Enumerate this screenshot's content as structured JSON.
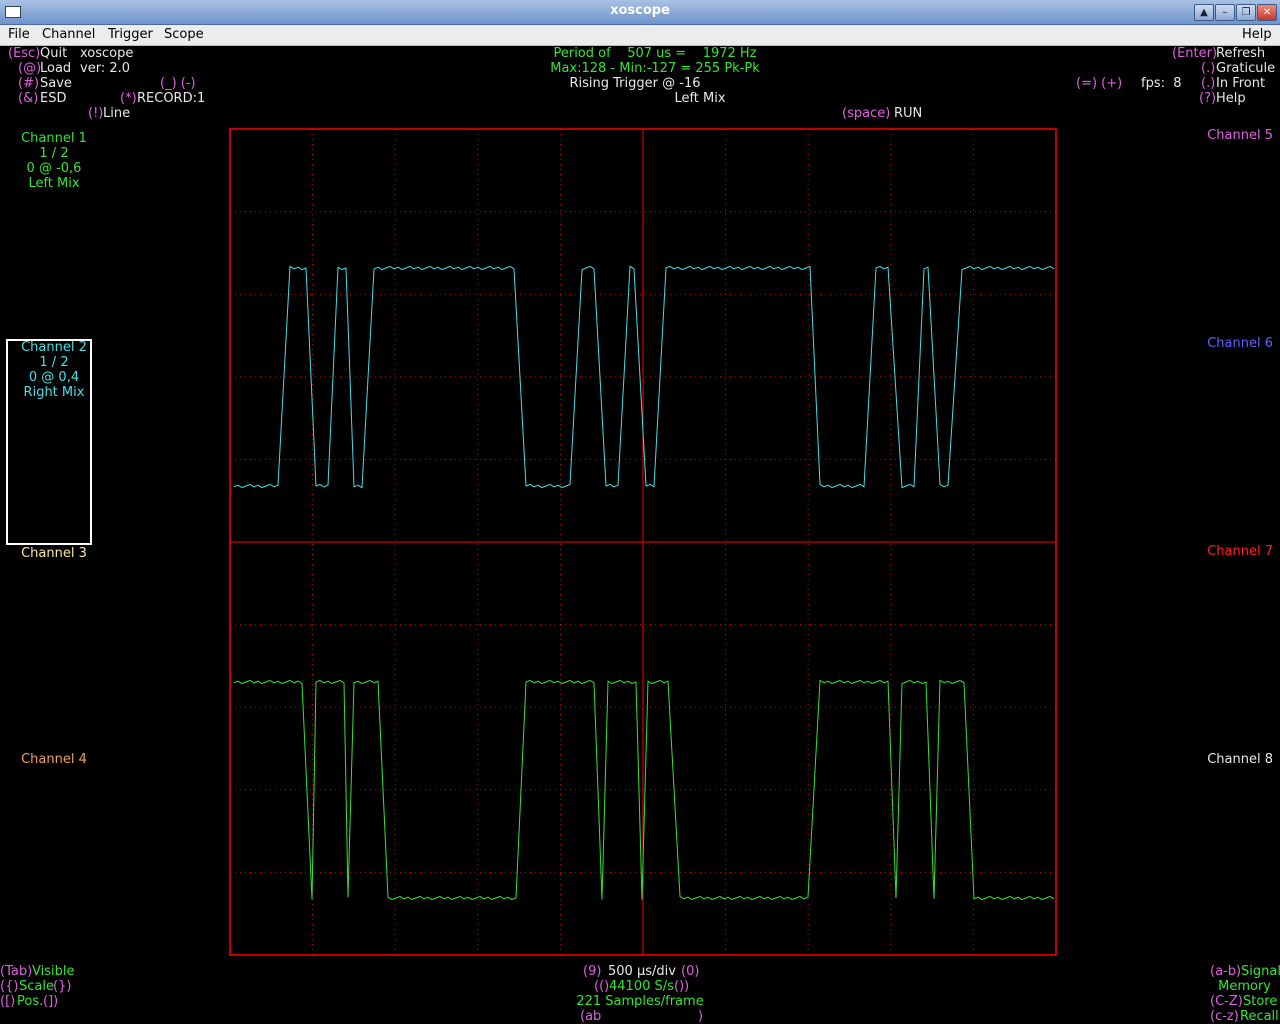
{
  "window": {
    "title": "xoscope"
  },
  "menu": [
    "File",
    "Channel",
    "Trigger",
    "Scope",
    "Help"
  ],
  "top_left": {
    "quit_key": "(Esc)",
    "quit_label": "Quit",
    "app_name": "xoscope",
    "load_key": "(@)",
    "load_label": "Load",
    "version": "ver: 2.0",
    "save_key": "(#)",
    "save_label": "Save",
    "scale_keys": "(_) (-)",
    "esd_key": "(&)",
    "esd_label": "ESD",
    "record_key": "(*)",
    "record_label": "RECORD:1",
    "line_key": "(!)",
    "line_label": "Line"
  },
  "top_center": {
    "period": "Period of    507 us =    1972 Hz",
    "minmax": "Max:128 - Min:-127 = 255 Pk-Pk",
    "trigger": "Rising Trigger @ -16",
    "source": "Left Mix",
    "run_key": "(space)",
    "run_label": "RUN"
  },
  "top_right": {
    "refresh_key": "(Enter)",
    "refresh_label": "Refresh",
    "graticule_key": "(.)",
    "graticule_label": "Graticule",
    "fps_keys": "(=) (+)",
    "fps_label": "fps:  8",
    "front_key": "(.)",
    "front_label": "In Front",
    "help_key": "(?)",
    "help_label": "Help"
  },
  "channels_left": [
    {
      "name": "Channel 1",
      "scale": "1 / 2",
      "pos": "0 @ -0,6",
      "source": "Left Mix"
    },
    {
      "name": "Channel 2",
      "scale": "1 / 2",
      "pos": "0 @ 0,4",
      "source": "Right Mix"
    },
    {
      "name": "Channel 3"
    },
    {
      "name": "Channel 4"
    }
  ],
  "channels_right": [
    "Channel 5",
    "Channel 6",
    "Channel 7",
    "Channel 8"
  ],
  "bottom_left": {
    "visible_key": "(Tab)",
    "visible_label": "Visible",
    "scale_key_l": "({)",
    "scale_label": "Scale",
    "scale_key_r": "(})",
    "pos_key_l": "([)",
    "pos_label": "Pos.",
    "pos_key_r": "(])"
  },
  "bottom_center": {
    "timebase_key_l": "(9)",
    "timebase": "500 µs/div",
    "timebase_key_r": "(0)",
    "rate_key_l": "(()",
    "rate": "44100 S/s",
    "rate_key_r": "())",
    "samples": "221 Samples/frame",
    "sig_l": "(ab",
    "sig_r": ")"
  },
  "bottom_right": {
    "signal_key": "(a-b)",
    "signal_label": "Signal",
    "memory_label": "Memory",
    "store_key": "(C-Z)",
    "store_label": "Store",
    "recall_key": "(c-z)",
    "recall_label": "Recall"
  },
  "colors": {
    "grid": "#ff0000",
    "ch1": "#32e632",
    "ch2": "#40e0e8",
    "keys": "#e060e0"
  }
}
